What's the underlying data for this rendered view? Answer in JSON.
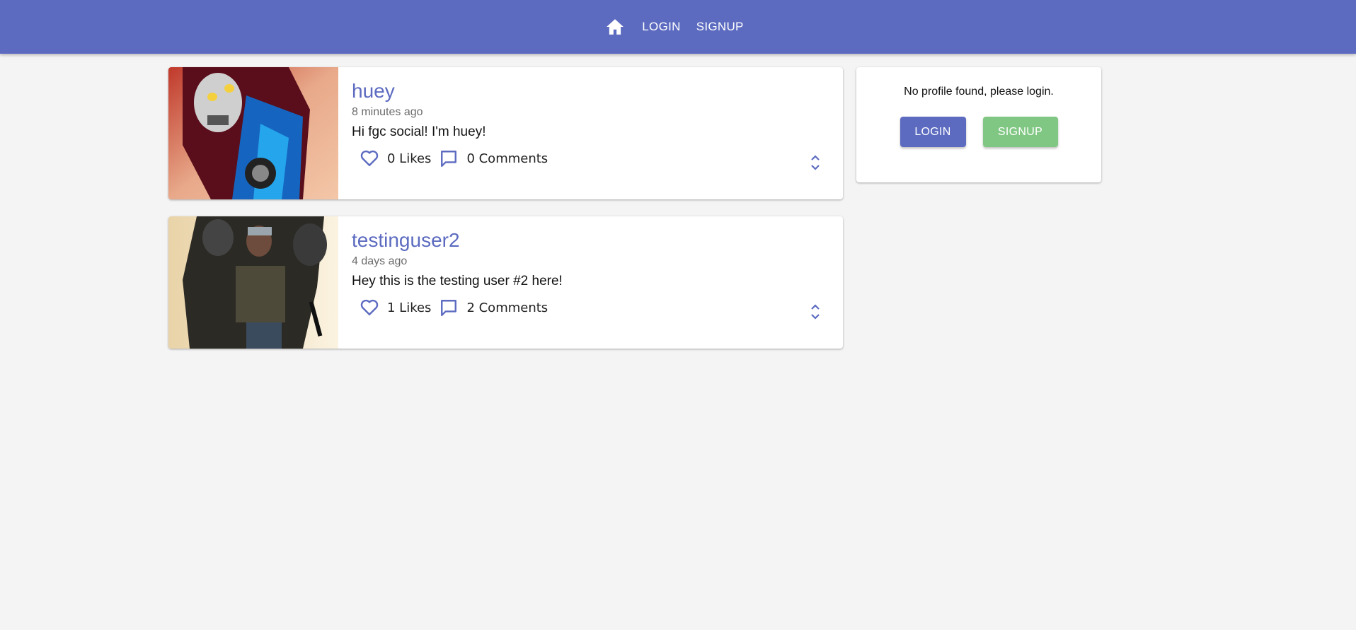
{
  "navbar": {
    "home_icon": "home-icon",
    "links": [
      "LOGIN",
      "SIGNUP"
    ]
  },
  "posts": [
    {
      "username": "huey",
      "time": "8 minutes ago",
      "body": "Hi fgc social! I'm huey!",
      "likes": "0 Likes",
      "comments": "0 Comments"
    },
    {
      "username": "testinguser2",
      "time": "4 days ago",
      "body": "Hey this is the testing user #2 here!",
      "likes": "1 Likes",
      "comments": "2 Comments"
    }
  ],
  "profile": {
    "message": "No profile found, please login.",
    "login_label": "LOGIN",
    "signup_label": "SIGNUP"
  },
  "colors": {
    "primary": "#5c6bc0",
    "secondary": "#81c784",
    "background": "#f4f4f4"
  }
}
